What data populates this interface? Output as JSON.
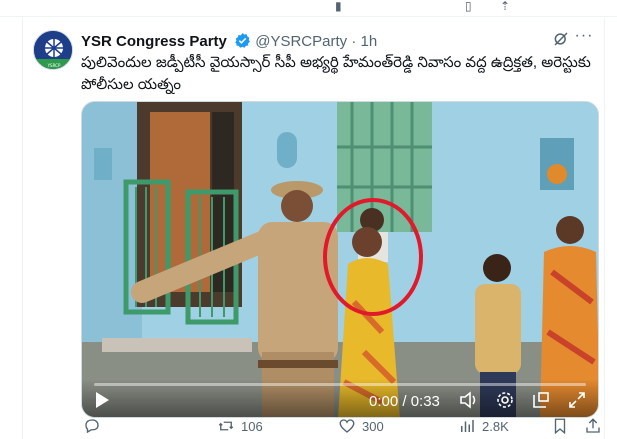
{
  "post": {
    "author_name": "YSR Congress Party",
    "handle": "@YSRCParty",
    "separator": "·",
    "time_ago": "1h",
    "text": "పులివెందుల జడ్పీటీసీ వైయస్సార్ సీపీ అభ్యర్థి హేమంత్‌రెడ్డి నివాసం వద్ద ఉద్రిక్తత, అరెస్టుకు పోలీసుల యత్నం"
  },
  "video": {
    "time_display": "0:00 / 0:33",
    "progress": 0.0
  },
  "actions": {
    "reposts": "106",
    "likes": "300",
    "views": "2.8K"
  },
  "colors": {
    "accent": "#1d9bf0",
    "text_primary": "#0f1419",
    "text_secondary": "#536471",
    "annotation_circle": "#e0192b"
  },
  "icons": [
    "verified-badge-icon",
    "grok-icon",
    "more-icon",
    "play-icon",
    "volume-icon",
    "settings-icon",
    "pip-icon",
    "fullscreen-icon",
    "reply-icon",
    "repost-icon",
    "like-icon",
    "views-icon",
    "bookmark-icon",
    "share-icon"
  ]
}
